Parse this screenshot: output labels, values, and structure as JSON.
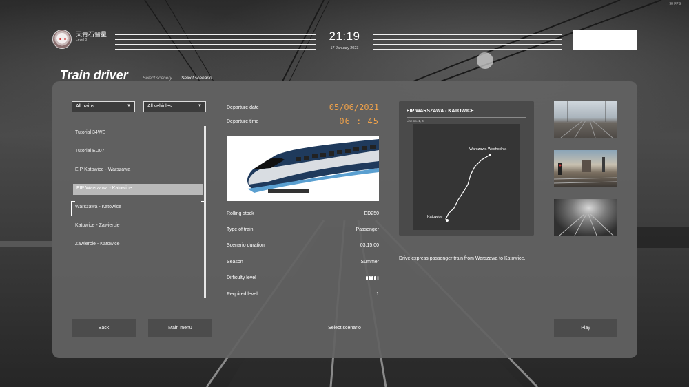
{
  "system": {
    "fps": "90 FPS"
  },
  "user": {
    "name": "天青石彗星",
    "level": "Level 0"
  },
  "clock": {
    "time": "21:19",
    "date": "17 January 2023"
  },
  "page": {
    "title": "Train driver",
    "breadcrumb": [
      "Select scenery",
      "Select scenario"
    ]
  },
  "filters": {
    "trains": {
      "value": "All trains",
      "icon": "chevron-down-icon"
    },
    "vehicles": {
      "value": "All vehicles",
      "icon": "chevron-down-icon"
    }
  },
  "scenarios": [
    "Tutorial 34WE",
    "Tutorial EU07",
    "EIP Katowice - Warszawa",
    "EIP Warszawa - Katowice",
    "Warszawa - Katowice",
    "Katowice - Zawiercie",
    "Zawiercie - Katowice"
  ],
  "selected_scenario_index": 3,
  "focused_scenario_index": 4,
  "departure": {
    "date_label": "Departure date",
    "date_value": "05/06/2021",
    "time_label": "Departure time",
    "time_value": "06 : 45"
  },
  "details": {
    "rolling_stock_label": "Rolling stock",
    "rolling_stock_value": "ED250",
    "type_label": "Type of train",
    "type_value": "Passenger",
    "duration_label": "Scenario duration",
    "duration_value": "03:15:00",
    "season_label": "Season",
    "season_value": "Summer",
    "difficulty_label": "Difficulty level",
    "difficulty_value": 4,
    "difficulty_max": 5,
    "required_level_label": "Required level",
    "required_level_value": "1"
  },
  "route_map": {
    "title": "EIP WARSZAWA - KATOWICE",
    "line": "Line no. 1, 4",
    "start": "Warszawa Wschodnia",
    "end": "Katowice"
  },
  "description": "Drive express passenger train from Warszawa to Katowice.",
  "buttons": {
    "back": "Back",
    "main_menu": "Main menu",
    "select_scenario": "Select scenario",
    "play": "Play"
  },
  "colors": {
    "accent": "#f0a24a",
    "panel": "#626262"
  }
}
